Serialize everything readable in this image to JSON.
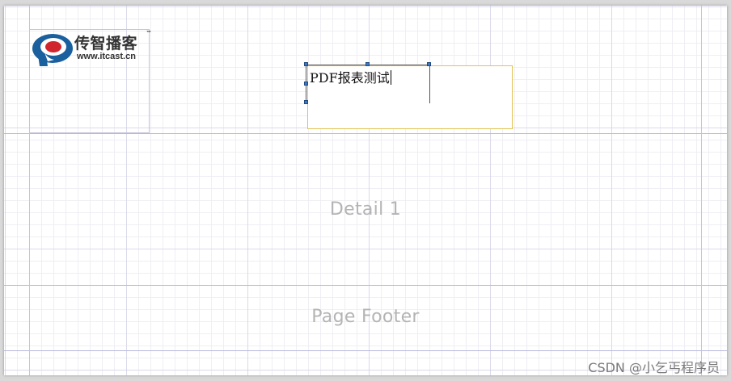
{
  "canvas": {
    "bands": {
      "detail_label": "Detail 1",
      "footer_label": "Page Footer"
    },
    "logo": {
      "title": "传智播客",
      "trademark": "™",
      "url": "www.itcast.cn",
      "icon": "itcast-logo-icon",
      "colors": {
        "blue": "#1a5f9e",
        "red": "#d0262d"
      }
    },
    "textbox": {
      "text": "PDF报表测试",
      "border_color": "#e2c250"
    },
    "selection_handle_color": "#3b78c8"
  },
  "watermark": {
    "text": "CSDN @小乞丐程序员"
  }
}
